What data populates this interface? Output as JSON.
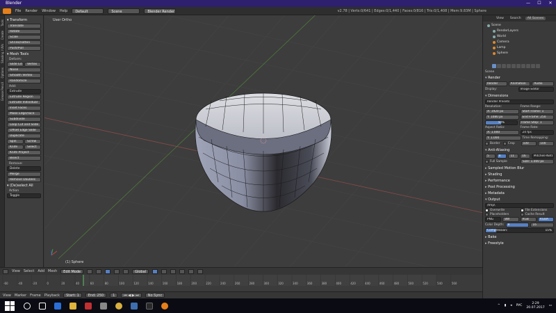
{
  "window": {
    "title": "Blender",
    "controls": [
      "—",
      "☐",
      "✕"
    ]
  },
  "infobar": {
    "menus": [
      "File",
      "Render",
      "Window",
      "Help"
    ],
    "layout": "Default",
    "scene": "Scene",
    "engine": "Blender Render",
    "stats": "v2.78 | Verts:0/641 | Edges:0/1,440 | Faces:0/816 | Tris:0/1,408 | Mem:9.83M | Sphere"
  },
  "tool_tabs": [
    "Tools",
    "Create",
    "Shading / UVs",
    "Options",
    "Grease Pencil"
  ],
  "tools": {
    "transform_header": "Transform",
    "transform": [
      "Translate",
      "Rotate",
      "Scale",
      "Shrink/Fatten",
      "Push/Pull"
    ],
    "mesh_tools_header": "Mesh Tools",
    "deform_label": "Deform:",
    "deform_row": [
      "Slide Ed",
      "Vertex"
    ],
    "deform": [
      "Noise",
      "Smooth Vertex",
      "Randomize"
    ],
    "add_label": "Add:",
    "extrude_dd": "Extrude",
    "add": [
      "Extrude Region",
      "Extrude Individual",
      "Inset Faces",
      "Make Edge/Face",
      "Subdivide",
      "Loop Cut and Slide",
      "Offset Edge Slide",
      "Duplicate"
    ],
    "add_row1": [
      "Spin",
      "Screw"
    ],
    "add_row2": [
      "Knife",
      "Select"
    ],
    "add_more": [
      "Knife Project",
      "Bisect"
    ],
    "remove_label": "Remove:",
    "delete_dd": "Delete",
    "remove": [
      "Merge",
      "Remove Doubles"
    ],
    "op_header": "(De)select All",
    "action_label": "Action",
    "action_value": "Toggle"
  },
  "viewport": {
    "label": "User Ortho",
    "object": "(1) Sphere"
  },
  "viewport_header": {
    "menus": [
      "View",
      "Select",
      "Add",
      "Mesh"
    ],
    "mode": "Edit Mode",
    "orientation": "Global"
  },
  "timeline": {
    "ticks": [
      "-60",
      "-40",
      "-20",
      "0",
      "20",
      "40",
      "60",
      "80",
      "100",
      "120",
      "140",
      "160",
      "180",
      "200",
      "220",
      "240",
      "260",
      "280",
      "300",
      "320",
      "340",
      "360",
      "380",
      "400",
      "420",
      "440",
      "460",
      "480",
      "500",
      "520",
      "540",
      "560"
    ],
    "menus": [
      "View",
      "Marker",
      "Frame",
      "Playback"
    ],
    "start": "Start:",
    "start_value": "1",
    "end": "End:",
    "end_value": "250",
    "current": "1",
    "sync": "No Sync"
  },
  "outliner": {
    "tabs": [
      "View",
      "Search",
      "All Scenes"
    ],
    "items": [
      "Scene",
      "RenderLayers",
      "World",
      "Camera",
      "Lamp",
      "Sphere"
    ]
  },
  "properties": {
    "crumb": "Scene",
    "render_header": "Render",
    "render_buttons": [
      "Render",
      "Animation",
      "Audio"
    ],
    "display_label": "Display:",
    "display_value": "Image Editor",
    "dimensions_header": "Dimensions",
    "presets": "Render Presets",
    "resolution_label": "Resolution:",
    "frame_range_label": "Frame Range:",
    "res_x": "X:",
    "res_x_value": "1920 px",
    "res_y": "Y:",
    "res_y_value": "1080 px",
    "res_pct": "50%",
    "res_pct_fraction": 0.5,
    "start_frame": "Start Frame:",
    "start_frame_value": "1",
    "end_frame": "End Frame:",
    "end_frame_value": "250",
    "frame_step": "Frame Step:",
    "frame_step_value": "1",
    "aspect_label": "Aspect Ratio:",
    "frame_rate_label": "Frame Rate:",
    "aspect_x": "X:",
    "aspect_x_value": "1.000",
    "aspect_y": "Y:",
    "aspect_y_value": "1.000",
    "frame_rate": "24 fps",
    "time_remap": "Time Remapping:",
    "border": "Border",
    "crop": "Crop",
    "remap_old": "100",
    "remap_new": "100",
    "aa_header": "Anti-Aliasing",
    "aa_samples": [
      "5",
      "8",
      "11",
      "16"
    ],
    "aa_filter": "Mitchell-Netravali",
    "full_sample": "Full Sample",
    "aa_size": "Size:",
    "aa_size_value": "1.000 px",
    "collapsed": [
      "Sampled Motion Blur",
      "Shading",
      "Performance",
      "Post Processing",
      "Metadata"
    ],
    "output_header": "Output",
    "output_path": "/tmp\\",
    "overwrite": "Overwrite",
    "file_ext": "File Extensions",
    "placeholders": "Placeholders",
    "cache": "Cache Result",
    "format": "PNG",
    "color_modes": [
      "BW",
      "RGB",
      "RGBA"
    ],
    "color_depth": "Color Depth:",
    "depths": [
      "8",
      "16"
    ],
    "compression": "Compression:",
    "compression_value": "15%",
    "compression_fraction": 0.15,
    "bake_header": "Bake",
    "freestyle_header": "Freestyle"
  },
  "taskbar": {
    "lang": "РУС",
    "time": "2:29",
    "date": "20.07.2017"
  }
}
